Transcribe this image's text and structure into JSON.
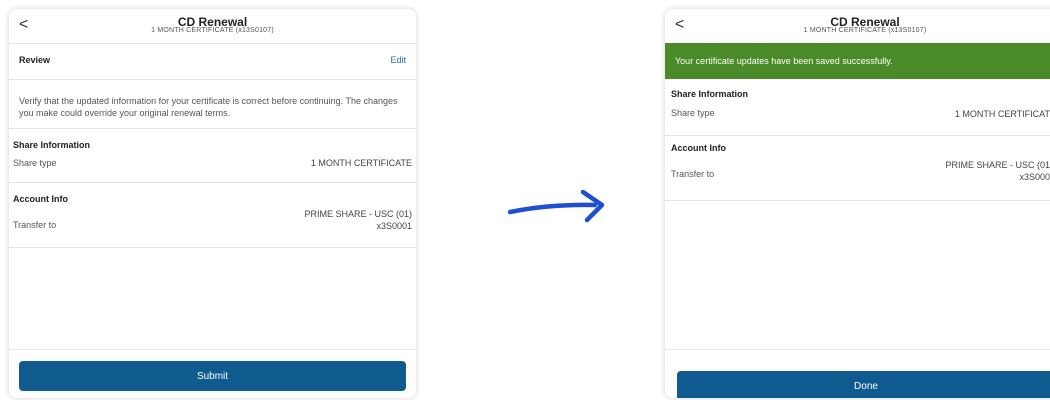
{
  "header": {
    "back_glyph": "<",
    "title": "CD Renewal",
    "subtitle": "1 MONTH CERTIFICATE (x13S0107)"
  },
  "left": {
    "review_label": "Review",
    "edit_label": "Edit",
    "verify_text_1": "Verify that the updated information for your certificate is correct before continuing. The changes",
    "verify_text_2": "you make could override your original renewal terms.",
    "share_info_title": "Share Information",
    "share_type_label": "Share type",
    "share_type_value": "1 MONTH CERTIFICATE",
    "account_info_title": "Account Info",
    "transfer_label": "Transfer to",
    "transfer_value_1": "PRIME SHARE - USC (01)",
    "transfer_value_2": "x3S0001",
    "submit_label": "Submit"
  },
  "right": {
    "banner_text": "Your certificate updates have been saved successfully.",
    "share_info_title": "Share Information",
    "share_type_label": "Share type",
    "share_type_value": "1 MONTH CERTIFICAT",
    "account_info_title": "Account Info",
    "transfer_label": "Transfer to",
    "transfer_value_1": "PRIME SHARE - USC (01",
    "transfer_value_2": "x3S000",
    "done_label": "Done"
  },
  "colors": {
    "primary_button": "#0f5a8f",
    "success_banner": "#4a8a28",
    "link": "#1f6fb5",
    "arrow": "#1f4fd1"
  },
  "icons": {
    "back": "chevron-left-icon",
    "arrow": "arrow-right-icon"
  }
}
